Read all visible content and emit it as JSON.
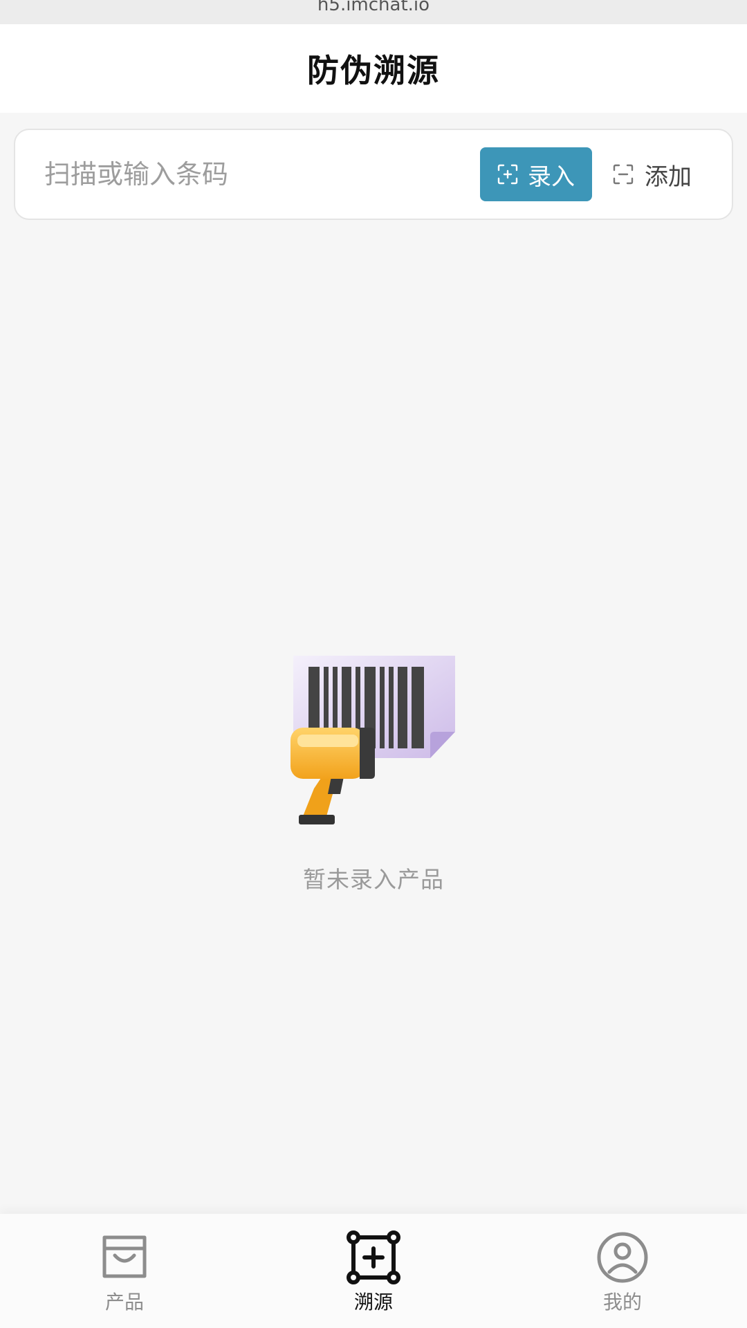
{
  "browser": {
    "url": "h5.imchat.io"
  },
  "header": {
    "title": "防伪溯源"
  },
  "search": {
    "placeholder": "扫描或输入条码",
    "record_label": "录入",
    "add_label": "添加"
  },
  "empty_state": {
    "message": "暂未录入产品",
    "illustration": "barcode-scanner-icon"
  },
  "tabs": [
    {
      "label": "产品",
      "icon": "shopping-bag-icon",
      "active": false
    },
    {
      "label": "溯源",
      "icon": "trace-network-icon",
      "active": true
    },
    {
      "label": "我的",
      "icon": "user-circle-icon",
      "active": false
    }
  ],
  "colors": {
    "accent": "#3d96b8",
    "background": "#f6f6f6",
    "active_tab": "#111111",
    "inactive_tab": "#8d8d8d"
  }
}
